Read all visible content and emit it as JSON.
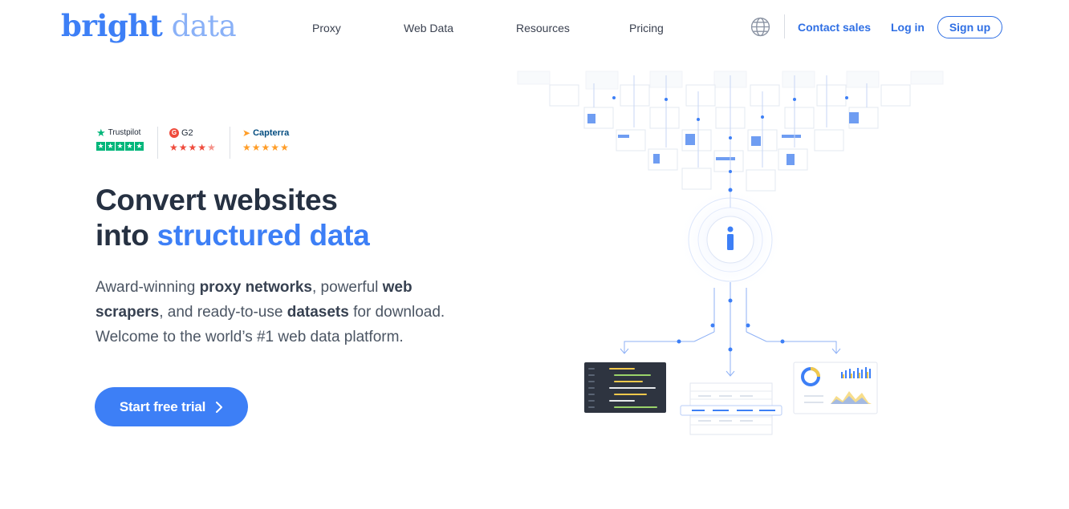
{
  "brand": {
    "logo_part1": "bright",
    "logo_part2": "data"
  },
  "nav": {
    "items": [
      "Proxy",
      "Web Data",
      "Resources",
      "Pricing"
    ]
  },
  "header": {
    "contact_sales": "Contact sales",
    "log_in": "Log in",
    "sign_up": "Sign up",
    "globe_icon": "globe-icon"
  },
  "ratings": [
    {
      "name": "Trustpilot",
      "icon": "trustpilot-star-icon",
      "stars": 5,
      "color": "#00b67a"
    },
    {
      "name": "G2",
      "icon": "g2-logo-icon",
      "stars": 4.5,
      "color": "#ef4b3c"
    },
    {
      "name": "Capterra",
      "icon": "capterra-logo-icon",
      "stars": 5,
      "color": "#ff9d28"
    }
  ],
  "hero": {
    "title_line1": "Convert websites",
    "title_line2_prefix": "into ",
    "title_line2_accent": "structured data",
    "lead_1": "Award-winning ",
    "lead_b1": "proxy networks",
    "lead_2": ", powerful ",
    "lead_b2": "web scrapers",
    "lead_3": ", and ready-to-use ",
    "lead_b3": "datasets",
    "lead_4": " for download. Welcome to the world’s #1 web data platform.",
    "cta_label": "Start free trial"
  },
  "colors": {
    "accent": "#3d7ff6",
    "text_dark": "#263142",
    "link": "#2f6fe4"
  }
}
